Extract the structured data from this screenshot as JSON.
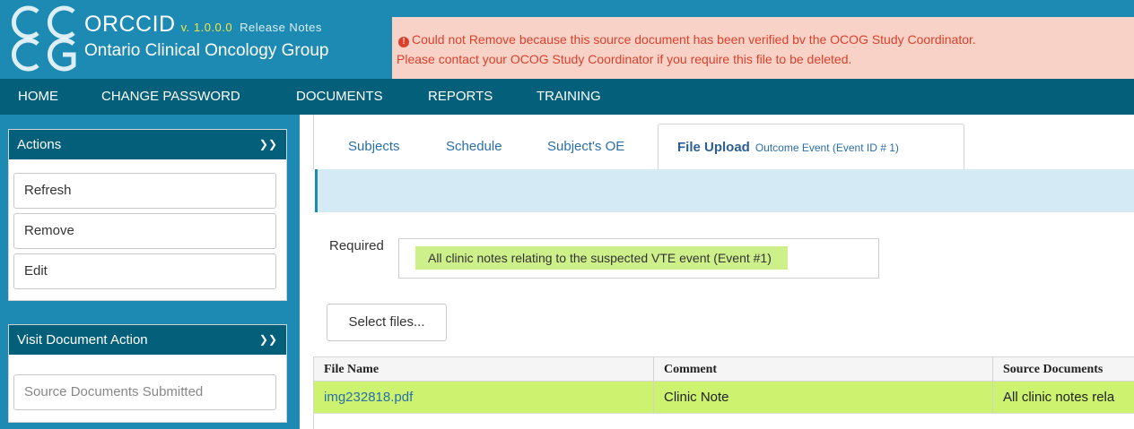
{
  "brand": {
    "name": "ORCCID",
    "version": "v. 1.0.0.0",
    "release_notes": "Release Notes",
    "org": "Ontario Clinical Oncology Group"
  },
  "alert": {
    "line1": "Could not Remove because this source document has been verified bv the OCOG Study Coordinator.",
    "line2": "Please contact your OCOG Study Coordinator if you require this file to be deleted."
  },
  "nav": {
    "items": [
      "HOME",
      "CHANGE PASSWORD",
      "DOCUMENTS",
      "REPORTS",
      "TRAINING"
    ]
  },
  "sidebar": {
    "actions": {
      "title": "Actions",
      "buttons": [
        "Refresh",
        "Remove",
        "Edit"
      ]
    },
    "visit": {
      "title": "Visit Document Action",
      "buttons": [
        "Source Documents Submitted"
      ]
    }
  },
  "tabs": {
    "items": [
      "Subjects",
      "Schedule",
      "Subject's OE"
    ],
    "active": {
      "title": "File Upload",
      "subtitle": "Outcome Event (Event ID # 1)"
    }
  },
  "required": {
    "label": "Required",
    "tag": "All clinic notes relating to the suspected VTE event (Event #1)"
  },
  "upload": {
    "select_label": "Select files..."
  },
  "grid": {
    "columns": [
      "File Name",
      "Comment",
      "Source Documents"
    ],
    "rows": [
      {
        "file": "img232818.pdf",
        "comment": "Clinic Note",
        "source": "All clinic notes rela"
      }
    ]
  },
  "colors": {
    "header": "#1d8ab3",
    "nav": "#035f7a",
    "alert_bg": "#f9d2c7",
    "alert_text": "#d9412c",
    "highlight": "#cdf26f"
  }
}
